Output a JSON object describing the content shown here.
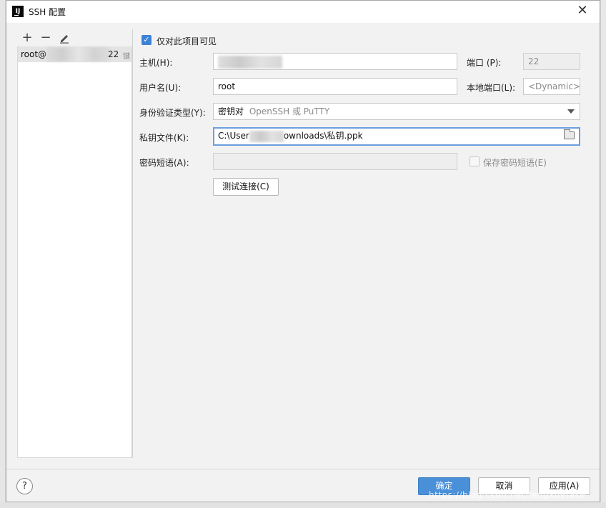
{
  "window": {
    "title": "SSH 配置",
    "close_glyph": "✕",
    "app_icon_letter": "IJ"
  },
  "toolbar": {
    "add": "+",
    "remove": "−",
    "edit_icon": "pencil-icon"
  },
  "hosts": {
    "items": [
      {
        "prefix": "root@",
        "suffix": "22",
        "tag": "键"
      }
    ]
  },
  "form": {
    "visible_only_label": "仅对此项目可见",
    "visible_only_checked": true,
    "host_label": "主机(H):",
    "host_value": "",
    "port_label": "端口 (P):",
    "port_value": "22",
    "username_label": "用户名(U):",
    "username_value": "root",
    "local_port_label": "本地端口(L):",
    "local_port_placeholder": "<Dynamic>",
    "auth_type_label": "身份验证类型(Y):",
    "auth_type_value": "密钥对",
    "auth_type_hint": "OpenSSH 或 PuTTY",
    "private_key_label": "私钥文件(K):",
    "private_key_value_start": "C:\\User",
    "private_key_value_end": "ownloads\\私钥.ppk",
    "passphrase_label": "密码短语(A):",
    "passphrase_value": "",
    "save_passphrase_label": "保存密码短语(E)",
    "save_passphrase_checked": false,
    "test_connection_label": "测试连接(C)"
  },
  "footer": {
    "help": "?",
    "ok": "确定",
    "cancel": "取消",
    "apply": "应用(A)",
    "watermark": "https://blog.csdn.net/fengxuefake"
  },
  "colors": {
    "accent": "#4a90d9",
    "focus": "#6a9fde",
    "checkbox": "#3d82d6"
  }
}
